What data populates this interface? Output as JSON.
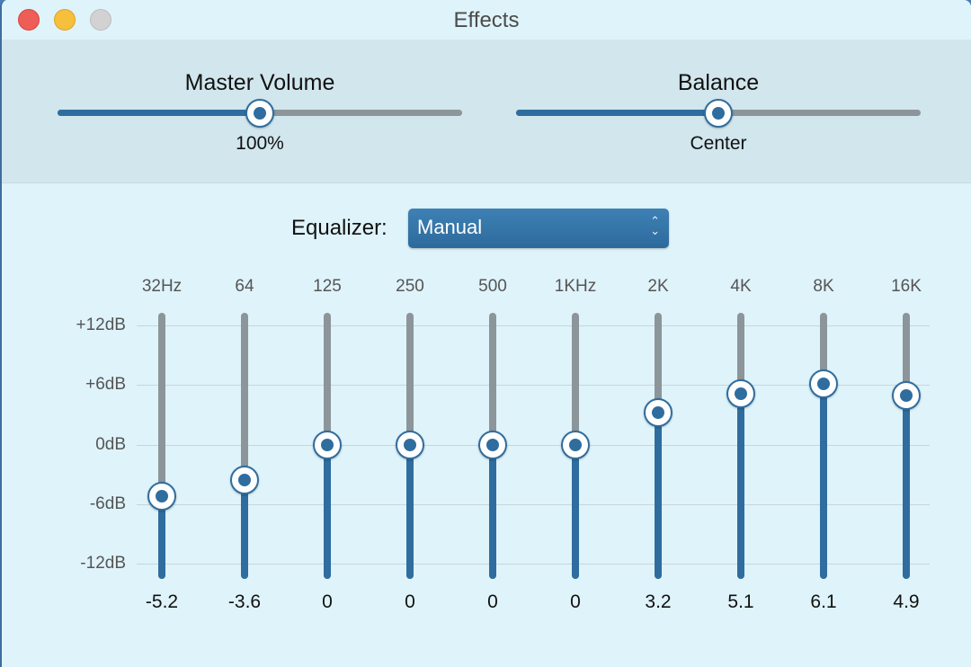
{
  "window": {
    "title": "Effects",
    "controls": [
      "close",
      "minimize",
      "zoom"
    ]
  },
  "master_volume": {
    "label": "Master Volume",
    "value_text": "100%",
    "level": 0.5
  },
  "balance": {
    "label": "Balance",
    "value_text": "Center",
    "level": 0.5
  },
  "equalizer": {
    "label": "Equalizer:",
    "preset": "Manual",
    "db_scale": [
      "+12dB",
      "+6dB",
      "0dB",
      "-6dB",
      "-12dB"
    ],
    "db_range": [
      -12,
      12
    ],
    "bands": [
      {
        "freq": "32Hz",
        "value": "-5.2"
      },
      {
        "freq": "64",
        "value": "-3.6"
      },
      {
        "freq": "125",
        "value": "0"
      },
      {
        "freq": "250",
        "value": "0"
      },
      {
        "freq": "500",
        "value": "0"
      },
      {
        "freq": "1KHz",
        "value": "0"
      },
      {
        "freq": "2K",
        "value": "3.2"
      },
      {
        "freq": "4K",
        "value": "5.1"
      },
      {
        "freq": "8K",
        "value": "6.1"
      },
      {
        "freq": "16K",
        "value": "4.9"
      }
    ]
  },
  "colors": {
    "accent": "#2f6d9f",
    "track": "#8c9599",
    "window_bg": "#dff3fa",
    "top_panel_bg": "#d1e6ed"
  }
}
